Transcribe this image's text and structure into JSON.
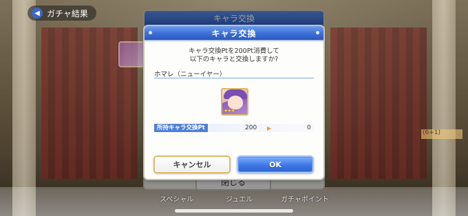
{
  "background": {
    "back_label": "ガチャ結果",
    "right_tag": "(6+1)",
    "bottom_tabs": [
      "スペシャル",
      "ジュエル",
      "ガチャポイント"
    ]
  },
  "under_dialog": {
    "title": "キャラ交換",
    "close_label": "閉じる"
  },
  "dialog": {
    "title": "キャラ交換",
    "message_line1": "キャラ交換Ptを200Pt消費して",
    "message_line2": "以下のキャラと交換しますか?",
    "character_name": "ホマレ（ニューイヤー）",
    "portrait_stars": "★★★",
    "pt_label": "所持キャラ交換Pt",
    "pt_before": "200",
    "pt_arrow": "▶",
    "pt_after": "0",
    "cancel_label": "キャンセル",
    "ok_label": "OK"
  },
  "colors": {
    "header_blue": "#3c6fd6",
    "ok_blue": "#3f78e6",
    "accent_orange": "#f29a2e"
  }
}
